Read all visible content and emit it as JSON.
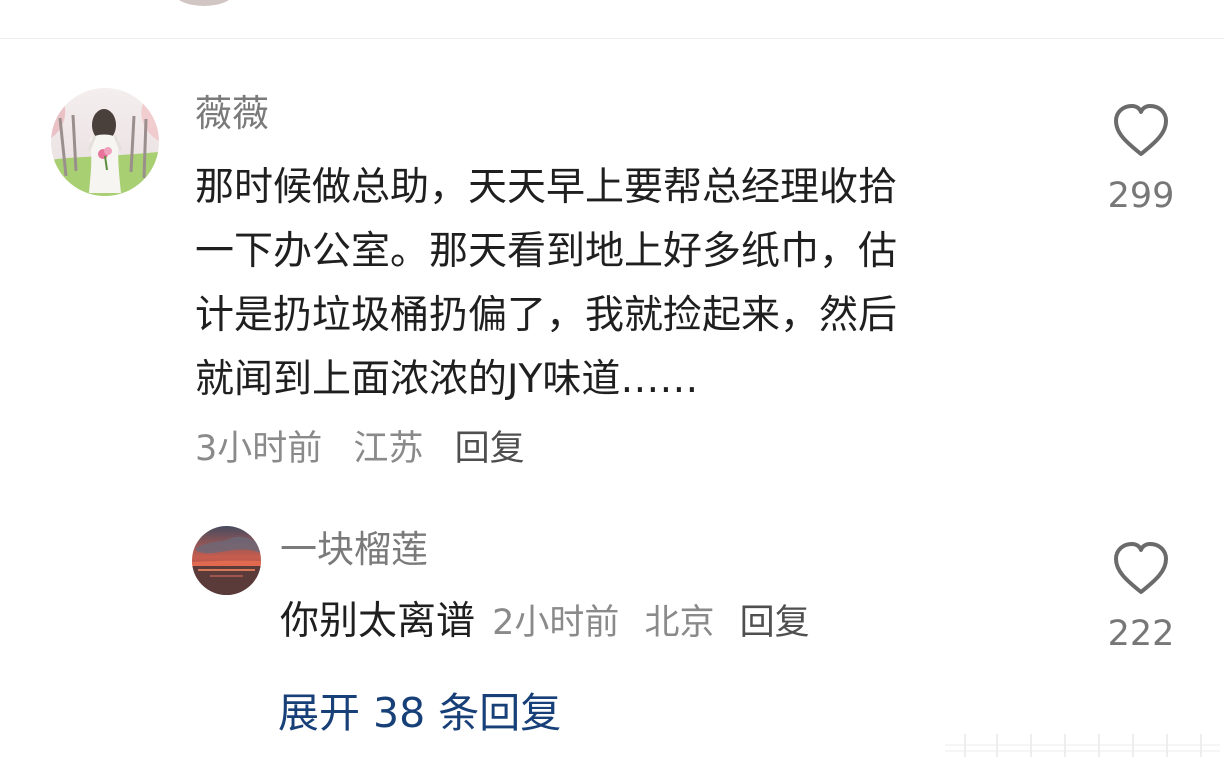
{
  "comment": {
    "author": "薇薇",
    "lines": [
      "那时候做总助，天天早上要帮总经理收拾",
      "一下办公室。那天看到地上好多纸巾，估",
      "计是扔垃圾桶扔偏了，我就捡起来，然后",
      "就闻到上面浓浓的JY味道……"
    ],
    "time": "3小时前",
    "location": "江苏",
    "reply_label": "回复",
    "likes": "299"
  },
  "reply": {
    "author": "一块榴莲",
    "text": "你别太离谱",
    "time": "2小时前",
    "location": "北京",
    "reply_label": "回复",
    "likes": "222"
  },
  "expand": {
    "label": "展开 38 条回复"
  },
  "icons": {
    "like": "heart-outline-icon",
    "main_avatar": "user-avatar-photo",
    "reply_avatar": "sunset-avatar-photo"
  },
  "colors": {
    "background": "#ffffff",
    "primary_text": "#1f1f1f",
    "secondary_text": "#8a8a8a",
    "link": "#173f78",
    "divider": "#eeeeee"
  }
}
